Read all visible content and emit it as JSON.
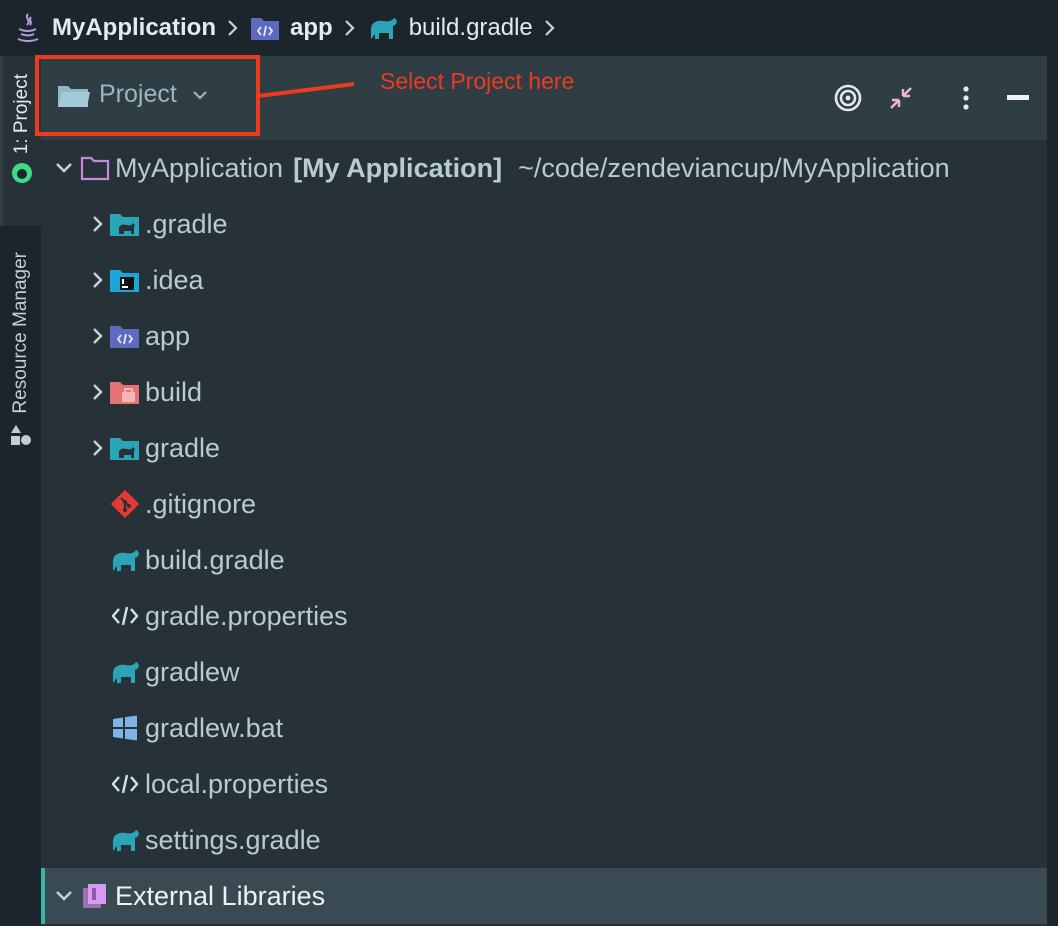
{
  "breadcrumb": {
    "project": "MyApplication",
    "module": "app",
    "file": "build.gradle"
  },
  "left_strip": {
    "project_tab": "1: Project",
    "resource_tab": "Resource Manager"
  },
  "panel": {
    "selector_label": "Project",
    "annotation": "Select Project here",
    "icons": [
      "locate-target-icon",
      "collapse-all-icon",
      "more-options-icon",
      "hide-panel-icon"
    ]
  },
  "tree": {
    "root": {
      "name": "MyApplication",
      "module": "[My Application]",
      "path": "~/code/zendeviancup/MyApplication"
    },
    "items": [
      {
        "label": ".gradle",
        "icon": "gradle-folder-icon",
        "expandable": true
      },
      {
        "label": ".idea",
        "icon": "idea-folder-icon",
        "expandable": true
      },
      {
        "label": "app",
        "icon": "module-folder-icon",
        "expandable": true
      },
      {
        "label": "build",
        "icon": "build-folder-icon",
        "expandable": true
      },
      {
        "label": "gradle",
        "icon": "gradle-folder-icon",
        "expandable": true
      },
      {
        "label": ".gitignore",
        "icon": "git-icon",
        "expandable": false
      },
      {
        "label": "build.gradle",
        "icon": "gradle-elephant-icon",
        "expandable": false
      },
      {
        "label": "gradle.properties",
        "icon": "code-icon",
        "expandable": false
      },
      {
        "label": "gradlew",
        "icon": "gradle-elephant-icon",
        "expandable": false
      },
      {
        "label": "gradlew.bat",
        "icon": "windows-icon",
        "expandable": false
      },
      {
        "label": "local.properties",
        "icon": "code-icon",
        "expandable": false
      },
      {
        "label": "settings.gradle",
        "icon": "gradle-elephant-icon",
        "expandable": false
      }
    ],
    "external": "External Libraries"
  },
  "colors": {
    "accent_red": "#ee3a1d",
    "gradle_teal": "#2aa5b8",
    "text": "#b7cbd3"
  }
}
